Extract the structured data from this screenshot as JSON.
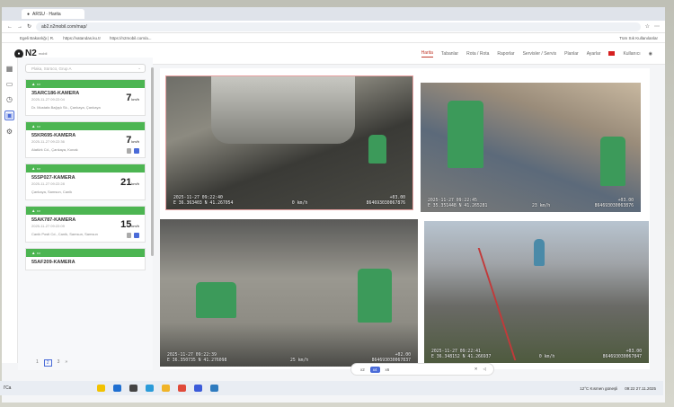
{
  "browser": {
    "tab1": "ARSU · Harita",
    "url": "ab2.n2mobil.com/map/",
    "bookmarks": [
      "Egeli Bakanlığı | R.",
      "https://vatandas.ku.tr",
      "https://n2mobil.com/a..."
    ],
    "bookmarks_right": "Tüm Sık Kullanılanlar"
  },
  "app": {
    "logo": "N2",
    "logo_sub": "mobil",
    "nav": [
      "Harita",
      "Tabanlar",
      "Rota / Rota",
      "Raporlar",
      "Servisler / Servis",
      "Planlar",
      "Ayarlar"
    ],
    "user": "Kullanıcı"
  },
  "rail_icons": [
    "map-icon",
    "monitor-icon",
    "clock-icon",
    "camera-icon",
    "gear-icon"
  ],
  "search": {
    "placeholder": "Plaka, Sürücü, Grup A"
  },
  "vehicles": [
    {
      "name": "35ARC186-KAMERA",
      "time": "2025-11-27 09:22:04",
      "address": "Dr. Mustafa Bağışlı Sk., Çankaya, Çankaya",
      "speed": "7"
    },
    {
      "name": "55KR695-KAMERA",
      "time": "2025-11-27 09:22:36",
      "address": "Atatürk Cd., Çankaya, Konak",
      "speed": "7"
    },
    {
      "name": "55SP027-KAMERA",
      "time": "2025-11-27 09:22:28",
      "address": "Çankaya, Samsun, Canik",
      "speed": "21"
    },
    {
      "name": "55AK787-KAMERA",
      "time": "2025-11-27 09:22:09",
      "address": "Canik Posti Cd., Canik, Samsun, Samsun",
      "speed": "15"
    },
    {
      "name": "55AF209-KAMERA",
      "time": "",
      "address": "",
      "speed": ""
    }
  ],
  "speed_unit": "km/h",
  "pager": [
    "1",
    "2",
    "3",
    "»"
  ],
  "cameras": [
    {
      "datetime": "2025-11-27 09:22:40",
      "coords": "E 36.363403  N 41.267054",
      "speed": "+03.00",
      "speed2": "0 km/h",
      "device": "864693030067876"
    },
    {
      "datetime": "2025-11-27 09:22:45",
      "coords": "E 35.351448  N 41.265281",
      "speed": "+03.00",
      "speed2": "23 km/h",
      "device": "864693030063876"
    },
    {
      "datetime": "2025-11-27 09:22:39",
      "coords": "E 36.350735  N 41.276098",
      "speed": "+02.00",
      "speed2": "25 km/h",
      "device": "864693030067837"
    },
    {
      "datetime": "2025-11-27 09:22:41",
      "coords": "E 36.348152  N 41.266937",
      "speed": "+03.00",
      "speed2": "0 km/h",
      "device": "864693030067847"
    }
  ],
  "controls": {
    "x2": "x2",
    "x4": "x4",
    "x6": "x6"
  },
  "taskbar": {
    "left": "l'Ca",
    "weather": "12°C  Kısmen güneşli",
    "clock": "09:22",
    "date": "27.11.2025"
  }
}
